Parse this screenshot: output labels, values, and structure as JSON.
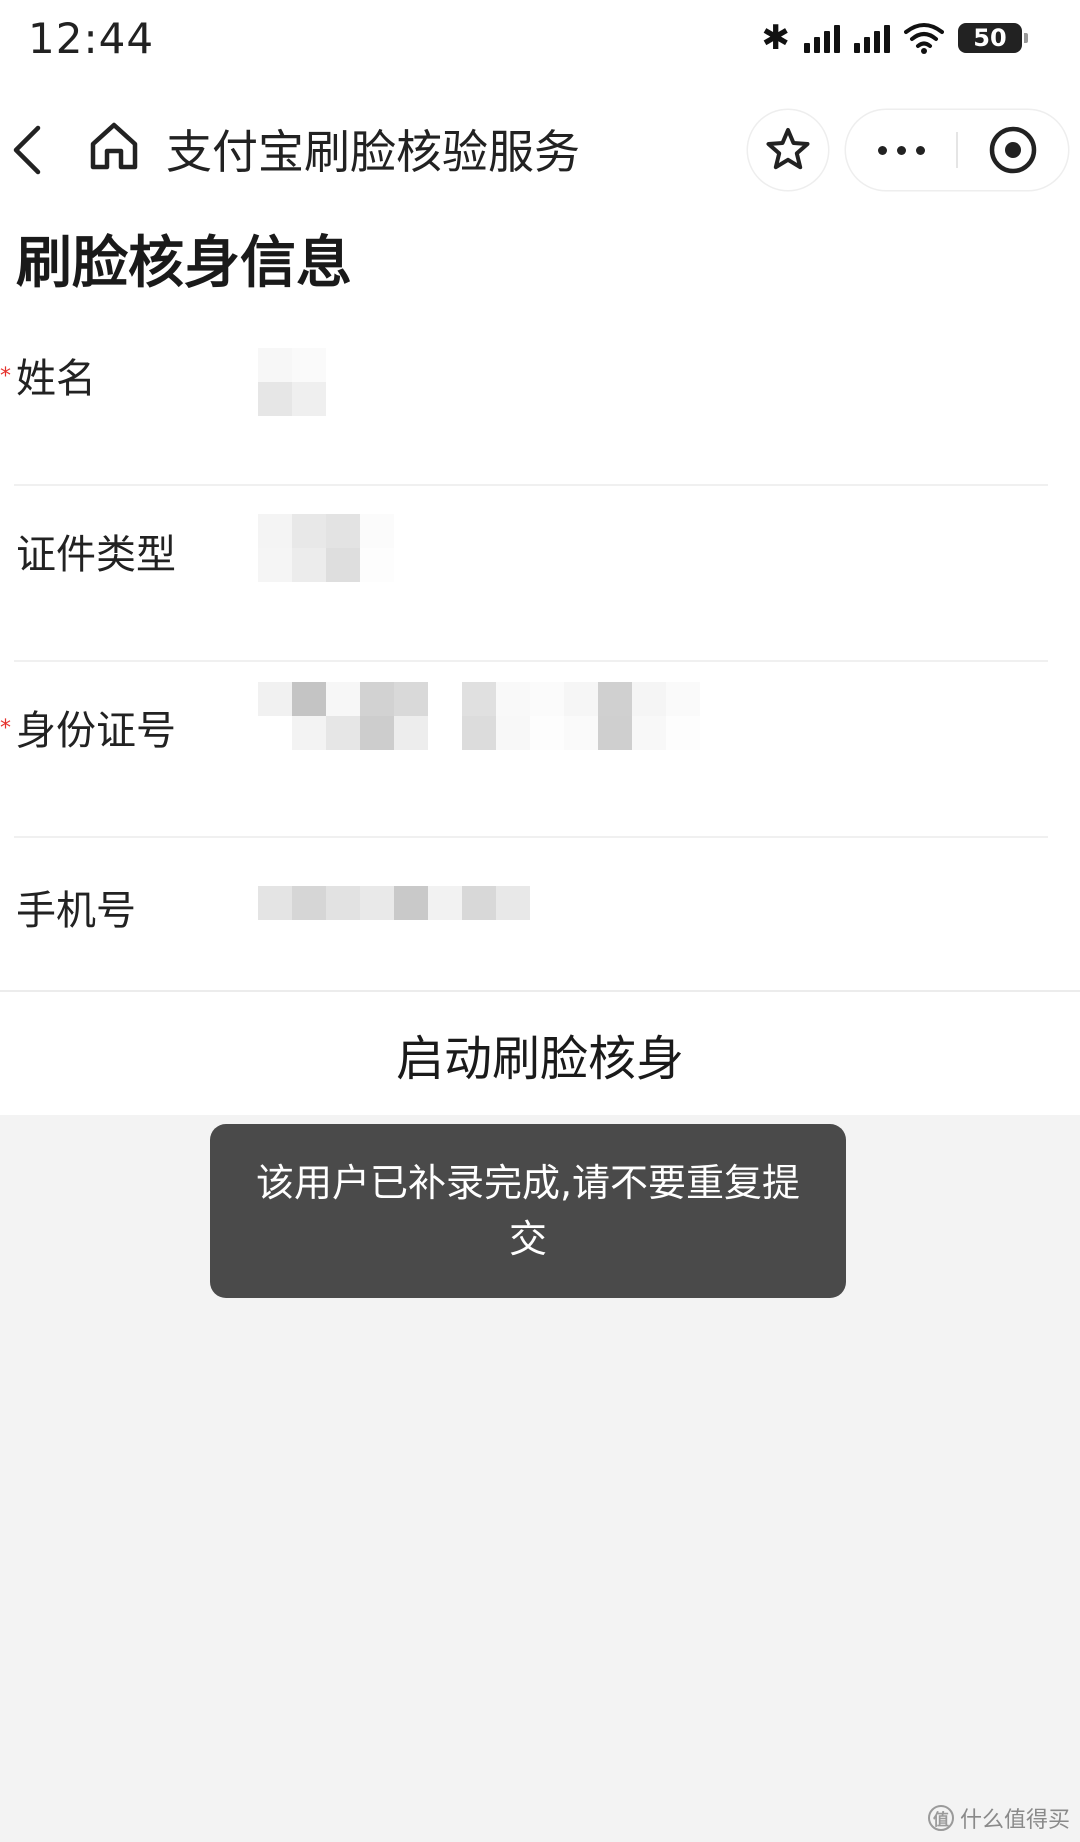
{
  "status_bar": {
    "time": "12:44",
    "battery": "50",
    "icons": [
      "bluetooth-icon",
      "signal-icon",
      "signal-icon",
      "wifi-icon",
      "battery-icon"
    ]
  },
  "nav": {
    "title": "支付宝刷脸核验服务",
    "back_icon": "chevron-left-icon",
    "home_icon": "home-icon",
    "favorite_icon": "star-icon",
    "more_icon": "more-dots-icon",
    "close_icon": "target-circle-icon"
  },
  "page": {
    "title": "刷脸核身信息"
  },
  "form": {
    "fields": [
      {
        "label": "姓名",
        "required": true,
        "value_visible": false
      },
      {
        "label": "证件类型",
        "required": false,
        "value_visible": false
      },
      {
        "label": "身份证号",
        "required": true,
        "value_visible": false
      },
      {
        "label": "手机号",
        "required": false,
        "value_visible": false
      }
    ],
    "required_mark": "*"
  },
  "action": {
    "label": "启动刷脸核身"
  },
  "toast": {
    "message": "该用户已补录完成,请不要重复提交"
  },
  "watermark": {
    "text": "什么值得买",
    "logo": "值"
  },
  "colors": {
    "required": "#e5322d",
    "toast_bg": "#4a4a4a",
    "page_bg": "#f3f3f3"
  }
}
